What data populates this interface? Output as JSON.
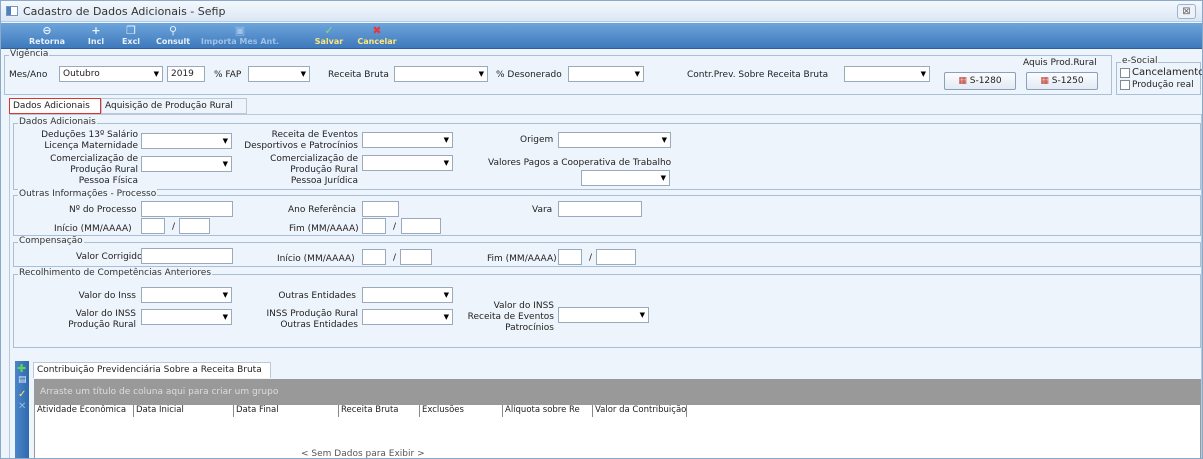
{
  "window": {
    "title": "Cadastro de Dados Adicionais - Sefip",
    "close": "⊠"
  },
  "toolbar": {
    "retorna": "Retorna",
    "incl": "Incl",
    "excl": "Excl",
    "consult": "Consult",
    "importa": "Importa Mes Ant.",
    "salvar": "Salvar",
    "cancelar": "Cancelar"
  },
  "vigencia": {
    "group": "Vigência",
    "mes_ano_label": "Mes/Ano",
    "mes": "Outubro",
    "ano": "2019",
    "fap_label": "% FAP",
    "fap": "",
    "receita_bruta_label": "Receita Bruta",
    "receita_bruta": "",
    "desonerado_label": "% Desonerado",
    "desonerado": "",
    "contr_label": "Contr.Prev. Sobre Receita Bruta",
    "contr": "",
    "aquis_label": "Aquis Prod.Rural",
    "s1280": "S-1280",
    "s1250": "S-1250"
  },
  "esocial": {
    "group": "e-Social",
    "cancelamento": "Cancelamento",
    "producao": "Produção real"
  },
  "tabs": {
    "dados": "Dados Adicionais",
    "aquisicao": "Aquisição de Produção Rural"
  },
  "dados_adicionais": {
    "group": "Dados Adicionais",
    "deducoes": [
      "Deduções 13º Salário",
      "Licença Maternidade"
    ],
    "receita_eventos": [
      "Receita de Eventos",
      "Desportivos e Patrocínios"
    ],
    "origem": "Origem",
    "com_pf": [
      "Comercialização de",
      "Produção Rural",
      "Pessoa Física"
    ],
    "com_pj": [
      "Comercialização de",
      "Produção Rural",
      "Pessoa Jurídica"
    ],
    "valores_coop": "Valores Pagos a Cooperativa de Trabalho"
  },
  "outras": {
    "group": "Outras Informações - Processo",
    "processo": "Nº do Processo",
    "ano_ref": "Ano Referência",
    "vara": "Vara",
    "inicio": "Início (MM/AAAA)",
    "fim": "Fim (MM/AAAA)",
    "slash": "/"
  },
  "compensacao": {
    "group": "Compensação",
    "valor": "Valor Corrigido",
    "inicio": "Início (MM/AAAA)",
    "fim": "Fim (MM/AAAA)",
    "slash": "/"
  },
  "recolhimento": {
    "group": "Recolhimento de Competências Anteriores",
    "inss": "Valor do Inss",
    "outras": "Outras Entidades",
    "inss_rural": [
      "Valor do INSS",
      "Produção Rural"
    ],
    "inss_rural_outras": [
      "INSS Produção Rural",
      "Outras Entidades"
    ],
    "inss_eventos": [
      "Valor do INSS",
      "Receita de Eventos",
      "Patrocínios"
    ]
  },
  "grid": {
    "tab": "Contribuição Previdenciária Sobre a Receita Bruta",
    "group_hint": "Arraste um título de coluna aqui para criar um grupo",
    "columns": [
      "Atividade Econômica",
      "Data Inicial",
      "Data Final",
      "Receita Bruta",
      "Exclusões",
      "Alíquota sobre Re",
      "Valor da Contribuição"
    ],
    "empty": "< Sem Dados para Exibir >"
  },
  "colors": {
    "toolbar": "#3e79bc",
    "accent": "#d33333",
    "panel": "#eef4fb"
  }
}
